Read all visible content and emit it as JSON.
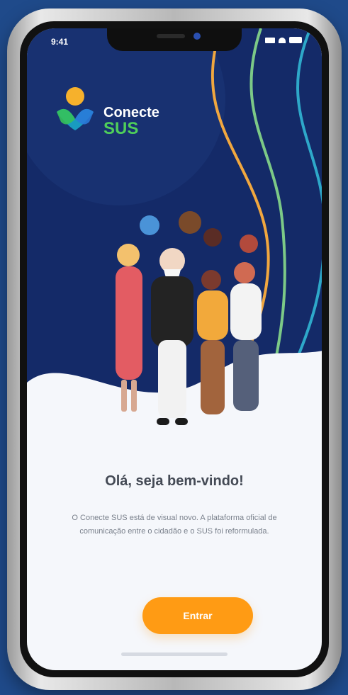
{
  "status_bar": {
    "time": "9:41"
  },
  "logo": {
    "line1": "Conecte",
    "line2": "SUS"
  },
  "content": {
    "title": "Olá, seja bem-vindo!",
    "description": "O Conecte SUS está de visual novo. A plataforma oficial de comunicação entre o cidadão e o SUS foi reformulada."
  },
  "actions": {
    "enter_label": "Entrar"
  },
  "colors": {
    "background": "#1f4a8a",
    "hero": "#142a68",
    "accent_orange": "#ff9b14",
    "sus_green": "#4fcf5a"
  },
  "icons": {
    "signal": "signal-icon",
    "wifi": "wifi-icon",
    "battery": "battery-icon"
  }
}
